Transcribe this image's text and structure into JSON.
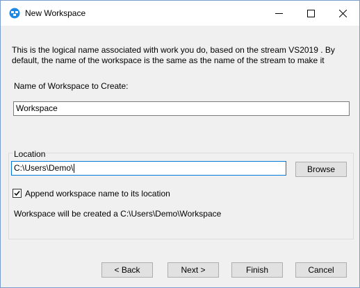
{
  "window": {
    "title": "New Workspace",
    "icon": "workspace-app-icon",
    "controls": [
      "minimize-icon",
      "maximize-icon",
      "close-icon"
    ]
  },
  "description": "This is the logical name associated with work you do, based on the stream VS2019 . By default, the name of the workspace is the same as the name of the stream to make it",
  "name_section": {
    "label": "Name of Workspace to Create:",
    "value": "Workspace"
  },
  "location_section": {
    "group_label": "Location",
    "path_value": "C:\\Users\\Demo\\",
    "browse_label": "Browse",
    "append_label": "Append workspace name to its location",
    "append_checked": true,
    "created_text": "Workspace will be created a C:\\Users\\Demo\\Workspace"
  },
  "footer": {
    "back_label": "< Back",
    "next_label": "Next >",
    "finish_label": "Finish",
    "cancel_label": "Cancel"
  },
  "colors": {
    "accent": "#0078d7",
    "button_bg": "#e1e1e1",
    "dialog_bg": "#f0f0f0"
  }
}
